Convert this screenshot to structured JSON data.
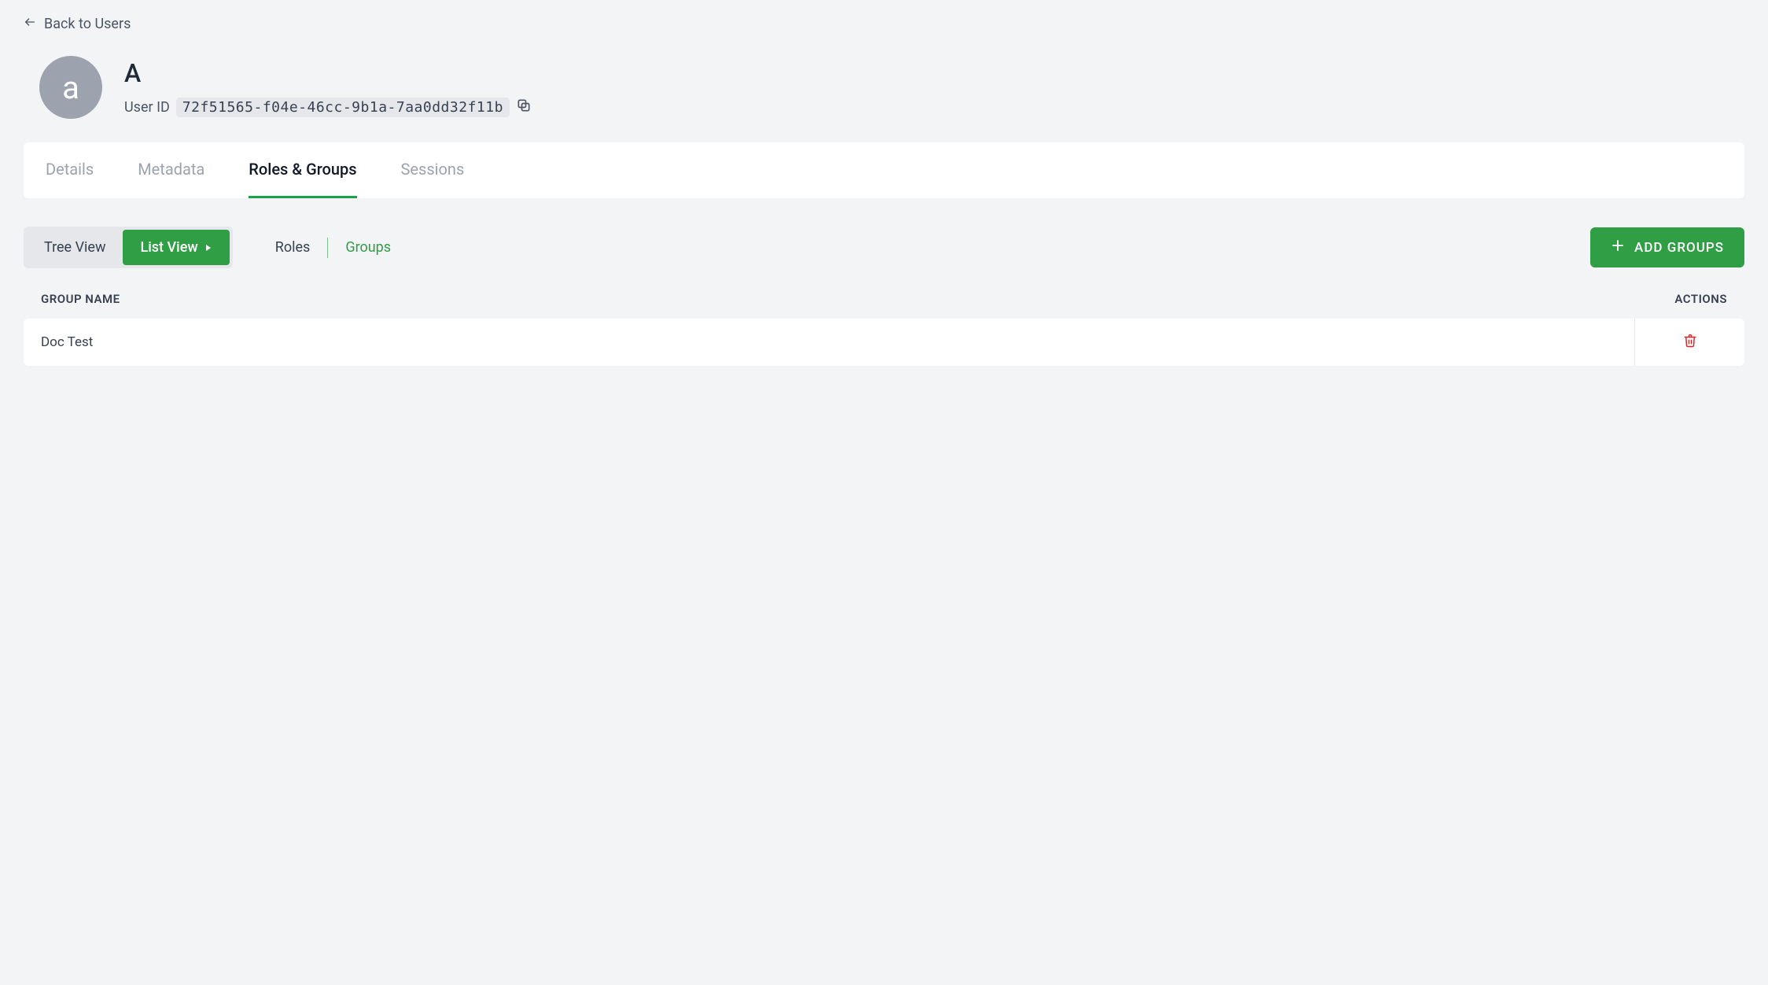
{
  "back_link": {
    "label": "Back to Users"
  },
  "user": {
    "avatar_letter": "a",
    "name": "A",
    "id_label": "User ID",
    "id_value": "72f51565-f04e-46cc-9b1a-7aa0dd32f11b"
  },
  "tabs": [
    {
      "label": "Details",
      "active": false
    },
    {
      "label": "Metadata",
      "active": false
    },
    {
      "label": "Roles & Groups",
      "active": true
    },
    {
      "label": "Sessions",
      "active": false
    }
  ],
  "view_toggle": {
    "tree": "Tree View",
    "list": "List View"
  },
  "subtabs": {
    "roles": "Roles",
    "groups": "Groups"
  },
  "add_button": "ADD GROUPS",
  "table": {
    "columns": {
      "name": "GROUP NAME",
      "actions": "ACTIONS"
    },
    "rows": [
      {
        "name": "Doc Test"
      }
    ]
  },
  "colors": {
    "accent": "#2f9e44",
    "danger": "#dc2626"
  }
}
